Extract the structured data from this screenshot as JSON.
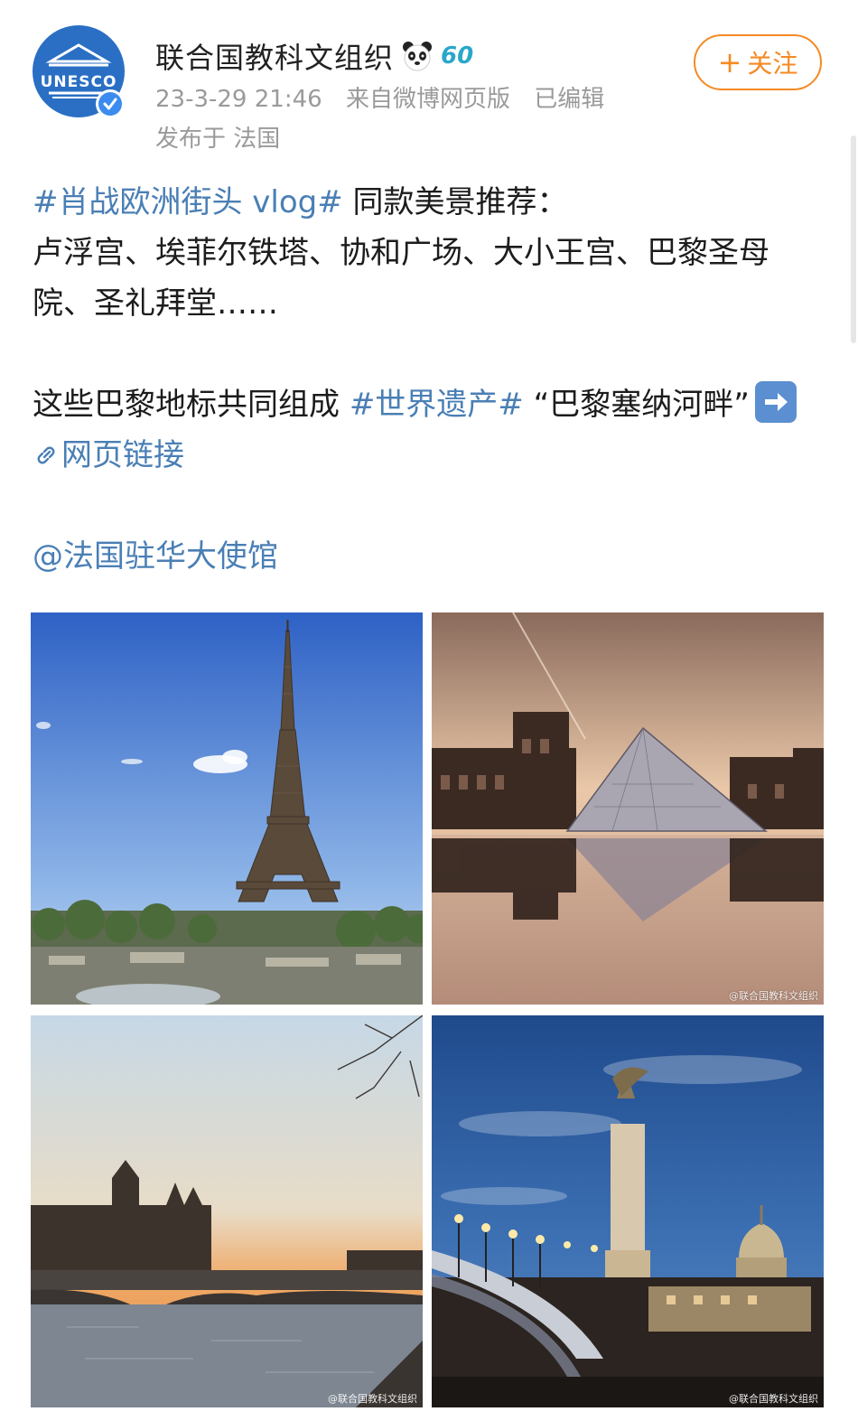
{
  "account": {
    "name": "联合国教科文组织",
    "avatar_text": "UNESCO",
    "badge_number": "60",
    "timestamp": "23-3-29 21:46",
    "source": "来自微博网页版",
    "edited": "已编辑",
    "location": "发布于 法国"
  },
  "follow_button": {
    "plus": "+",
    "label": "关注"
  },
  "post": {
    "hashtag1": "#肖战欧洲街头 vlog#",
    "line1_rest": " 同款美景推荐：",
    "line2": "卢浮宫、埃菲尔铁塔、协和广场、大小王宫、巴黎圣母院、圣礼拜堂……",
    "para2_start": "这些巴黎地标共同组成 ",
    "hashtag2": "#世界遗产#",
    "para2_mid": " “巴黎塞纳河畔”",
    "link_label": "网页链接",
    "mention": "@法国驻华大使馆"
  },
  "images": [
    {
      "name": "eiffel-tower-photo"
    },
    {
      "name": "louvre-pyramid-photo",
      "watermark": "@联合国教科文组织"
    },
    {
      "name": "seine-bridge-photo",
      "watermark": "@联合国教科文组织"
    },
    {
      "name": "pont-alexandre-photo",
      "watermark": "@联合国教科文组织"
    }
  ],
  "colors": {
    "link": "#4a7fb5",
    "follow": "#f58a24",
    "meta": "#9a9a9a",
    "avatar": "#2a6fc4"
  }
}
